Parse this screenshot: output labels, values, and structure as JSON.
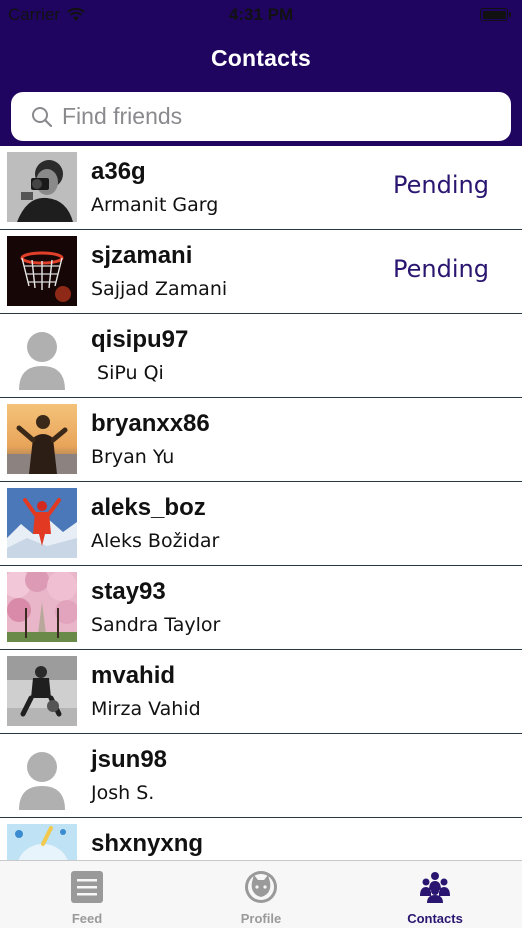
{
  "status_bar": {
    "carrier": "Carrier",
    "time": "4:31 PM"
  },
  "header": {
    "title": "Contacts"
  },
  "search": {
    "placeholder": "Find friends",
    "value": ""
  },
  "contacts": [
    {
      "username": "a36g",
      "name": "Armanit Garg",
      "status": "Pending",
      "avatar": "photo-man-camera"
    },
    {
      "username": "sjzamani",
      "name": "Sajjad Zamani",
      "status": "Pending",
      "avatar": "photo-basketball-hoop"
    },
    {
      "username": "qisipu97",
      "name": " SiPu Qi",
      "status": "",
      "avatar": "default-avatar"
    },
    {
      "username": "bryanxx86",
      "name": "Bryan Yu",
      "status": "",
      "avatar": "photo-sunset-man"
    },
    {
      "username": "aleks_boz",
      "name": "Aleks Božidar",
      "status": "",
      "avatar": "photo-mountain-climber"
    },
    {
      "username": "stay93",
      "name": "Sandra Taylor",
      "status": "",
      "avatar": "photo-cherry-blossoms"
    },
    {
      "username": "mvahid",
      "name": "Mirza Vahid",
      "status": "",
      "avatar": "photo-basketball-player"
    },
    {
      "username": "jsun98",
      "name": "Josh S.",
      "status": "",
      "avatar": "default-avatar"
    },
    {
      "username": "shxnyxng",
      "name": "",
      "status": "",
      "avatar": "photo-narwhal-cartoon"
    }
  ],
  "tabs": [
    {
      "label": "Feed",
      "icon": "feed-icon",
      "active": false
    },
    {
      "label": "Profile",
      "icon": "cat-icon",
      "active": false
    },
    {
      "label": "Contacts",
      "icon": "group-icon",
      "active": true
    }
  ],
  "colors": {
    "header_bg": "#1f0560",
    "accent": "#2a1670",
    "tab_inactive": "#9a9a9a"
  }
}
